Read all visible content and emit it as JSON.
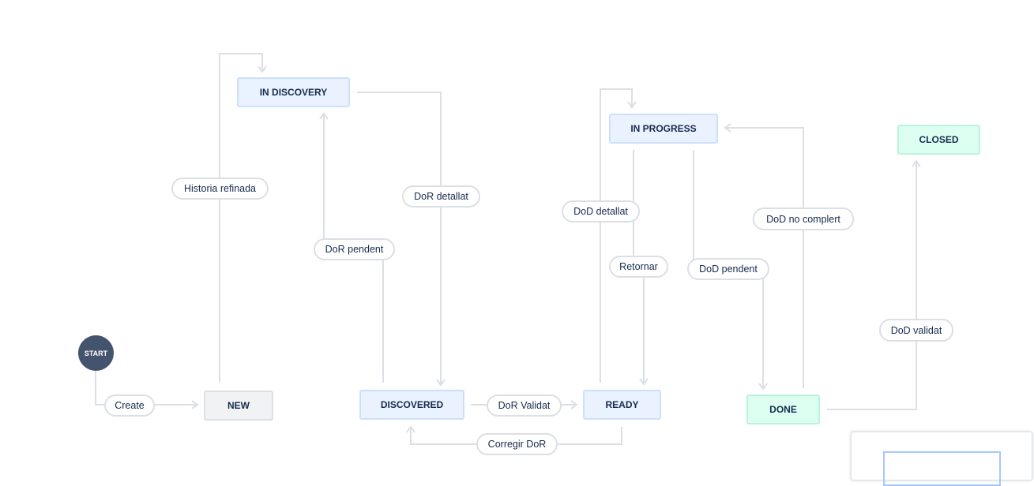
{
  "start": {
    "label": "START",
    "color": "#44546f"
  },
  "statuses": {
    "new": "NEW",
    "in_discovery": "IN DISCOVERY",
    "discovered": "DISCOVERED",
    "ready": "READY",
    "in_progress": "IN PROGRESS",
    "done": "DONE",
    "closed": "CLOSED"
  },
  "transitions": {
    "create": "Create",
    "historia_refinada": "Historia refinada",
    "dor_detallat": "DoR detallat",
    "dor_pendent": "DoR pendent",
    "dor_validat": "DoR Validat",
    "corregir_dor": "Corregir DoR",
    "dod_detallat": "DoD detallat",
    "retornar": "Retornar",
    "dod_pendent": "DoD pendent",
    "dod_no_complert": "DoD no complert",
    "dod_validat": "DoD validat"
  },
  "colors": {
    "todo": "#f1f2f4",
    "in_progress": "#e9f2fe",
    "done": "#dcfff1",
    "connector": "#dcdfe4"
  }
}
